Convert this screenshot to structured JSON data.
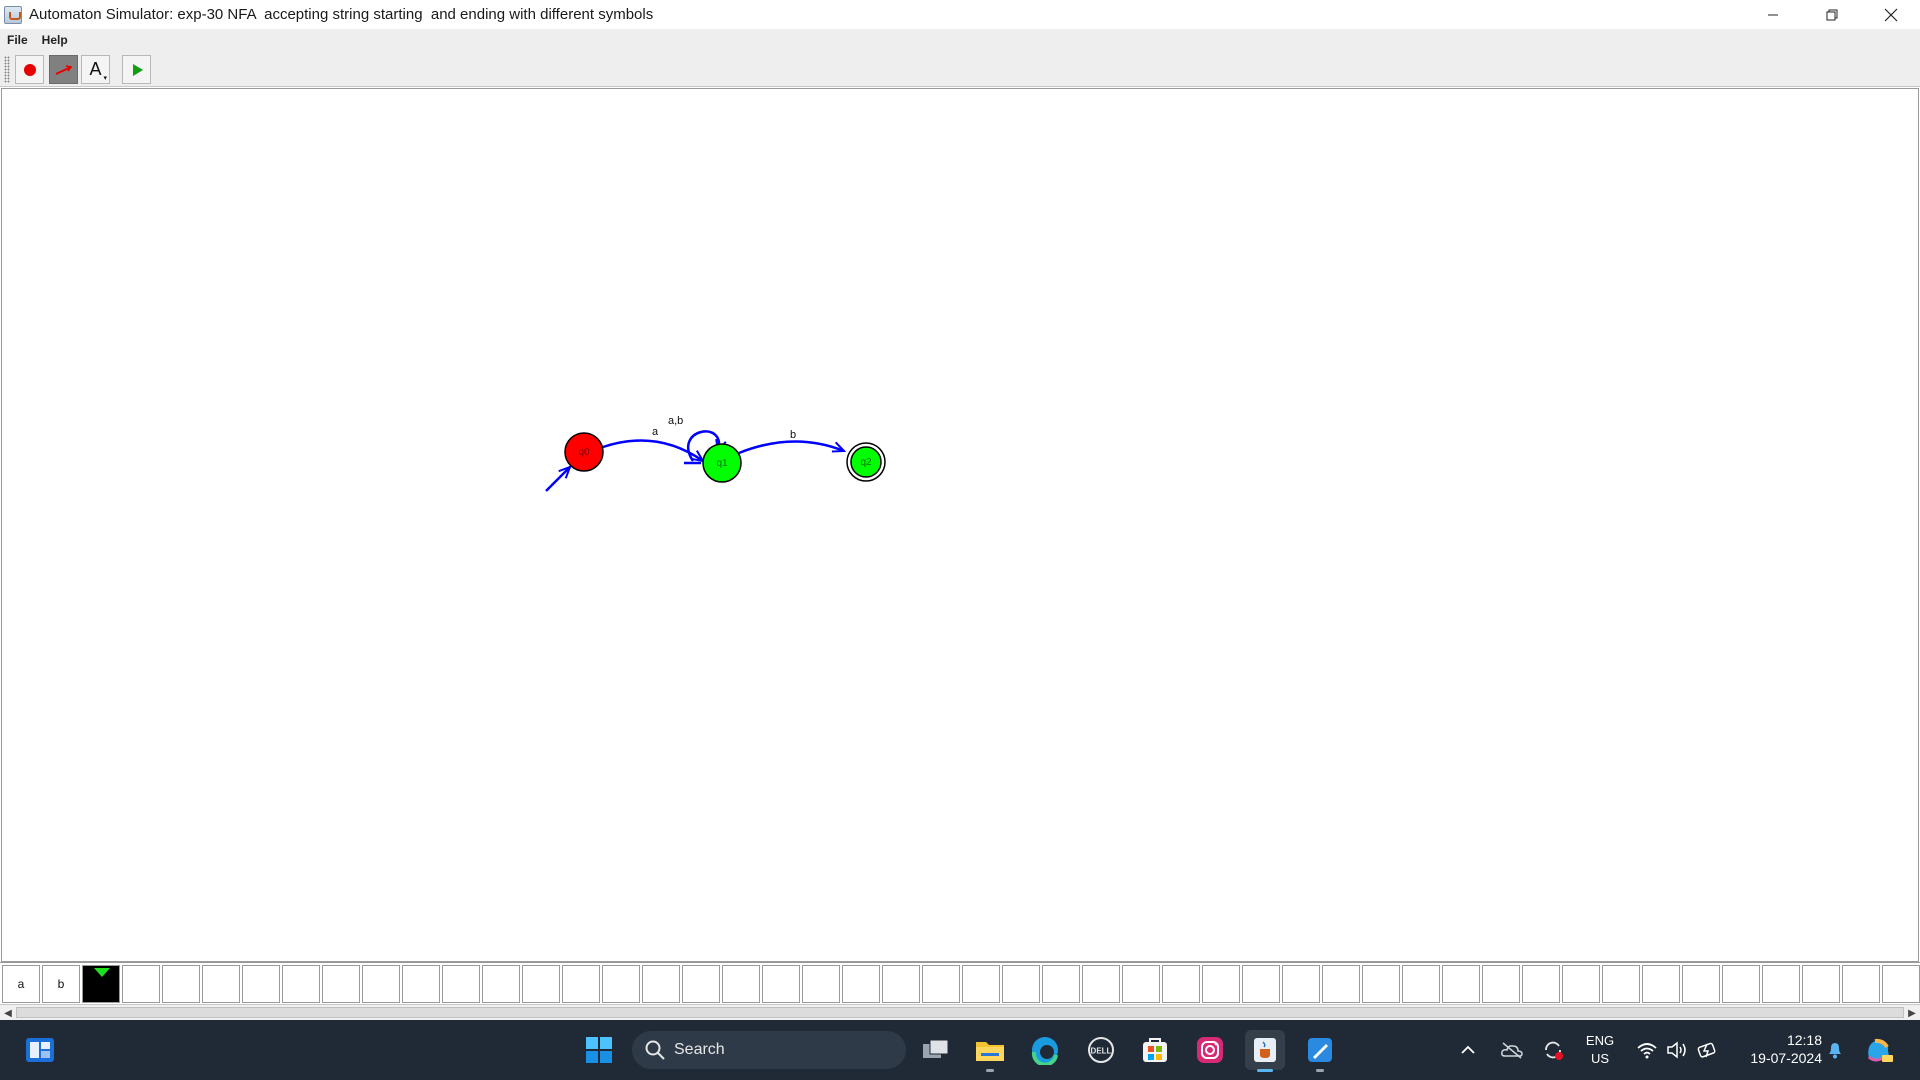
{
  "window": {
    "title": "Automaton Simulator: exp-30 NFA  accepting string starting  and ending with different symbols",
    "controls": {
      "minimize": "—",
      "restore": "❐",
      "close": "✕"
    }
  },
  "menu": {
    "file": "File",
    "help": "Help"
  },
  "toolbar": {
    "tools": [
      {
        "name": "state-tool",
        "icon": "red-circle-icon",
        "selected": false
      },
      {
        "name": "transition-tool",
        "icon": "transition-arrow-icon",
        "selected": true
      },
      {
        "name": "text-tool",
        "icon": "text-A-icon",
        "label": "A",
        "selected": false
      },
      {
        "name": "run-tool",
        "icon": "green-play-icon",
        "selected": false
      }
    ]
  },
  "automaton": {
    "states": [
      {
        "id": "q0",
        "label": "q0",
        "color": "#ff0000",
        "initial": true,
        "accepting": false
      },
      {
        "id": "q1",
        "label": "q1",
        "color": "#00ff00",
        "initial": false,
        "accepting": false
      },
      {
        "id": "q2",
        "label": "q2",
        "color": "#00ff00",
        "initial": false,
        "accepting": true
      }
    ],
    "transitions": [
      {
        "from": "q0",
        "to": "q1",
        "label": "a"
      },
      {
        "from": "q1",
        "to": "q1",
        "label": "a,b"
      },
      {
        "from": "q1",
        "to": "q2",
        "label": "b"
      }
    ],
    "edge_color": "#0000ff"
  },
  "tape": {
    "cells": [
      "a",
      "b",
      "",
      "",
      "",
      "",
      "",
      "",
      "",
      "",
      "",
      "",
      "",
      "",
      "",
      "",
      "",
      "",
      "",
      "",
      "",
      "",
      "",
      "",
      "",
      "",
      "",
      "",
      "",
      "",
      "",
      "",
      "",
      "",
      "",
      "",
      "",
      "",
      "",
      "",
      "",
      "",
      "",
      "",
      "",
      "",
      "",
      "",
      ""
    ],
    "head_index": 2
  },
  "taskbar": {
    "search_placeholder": "Search",
    "language": {
      "line1": "ENG",
      "line2": "US"
    },
    "clock": {
      "time": "12:18",
      "date": "19-07-2024"
    }
  }
}
